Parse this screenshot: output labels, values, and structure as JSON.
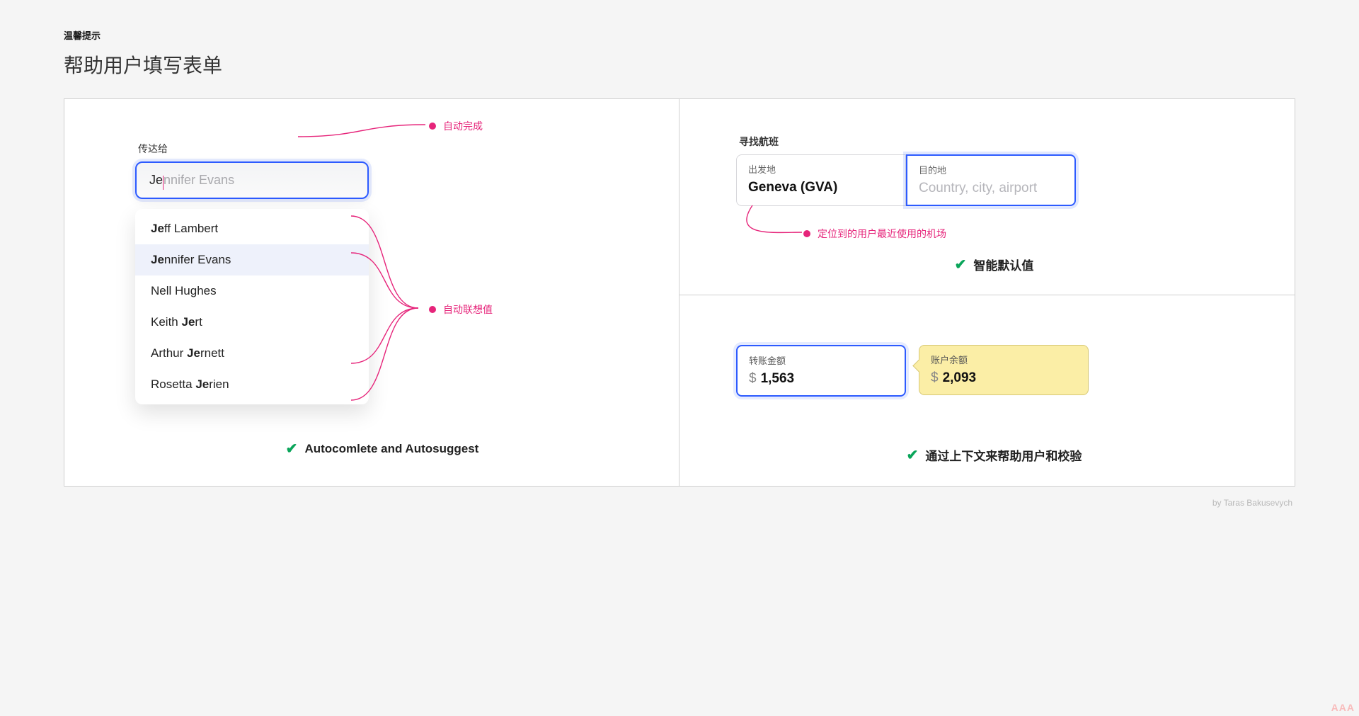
{
  "header": {
    "eyebrow": "温馨提示",
    "title": "帮助用户填写表单"
  },
  "left": {
    "field_label": "传达给",
    "input_typed": "Je",
    "input_ghost": "nnifer Evans",
    "callout_autocomplete": "自动完成",
    "callout_autosuggest": "自动联想值",
    "suggestions": [
      {
        "bold": "Je",
        "rest": "ff Lambert",
        "highlight": false
      },
      {
        "bold": "Je",
        "rest": "nnifer Evans",
        "highlight": true
      },
      {
        "bold": "",
        "rest": "Nell Hughes",
        "highlight": false
      },
      {
        "prefix": "Keith ",
        "bold": "Je",
        "rest": "rt",
        "highlight": false
      },
      {
        "prefix": "Arthur ",
        "bold": "Je",
        "rest": "rnett",
        "highlight": false
      },
      {
        "prefix": "Rosetta ",
        "bold": "Je",
        "rest": "rien",
        "highlight": false
      }
    ],
    "caption": "Autocomlete and Autosuggest"
  },
  "right_top": {
    "section_label": "寻找航班",
    "from_label": "出发地",
    "from_value": "Geneva (GVA)",
    "to_label": "目的地",
    "to_placeholder": "Country, city, airport",
    "callout_default": "定位到的用户最近使用的机场",
    "caption": "智能默认值"
  },
  "right_bottom": {
    "amount_label": "转账金额",
    "amount_value": "1,563",
    "balance_label": "账户余额",
    "balance_value": "2,093",
    "currency": "$",
    "caption": "通过上下文来帮助用户和校验"
  },
  "credit": "by Taras Bakusevych",
  "watermark": "AAA"
}
